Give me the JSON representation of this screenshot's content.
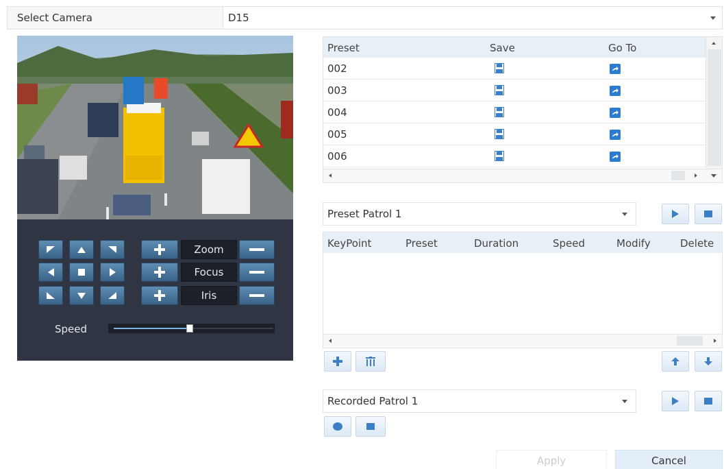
{
  "camera": {
    "label": "Select Camera",
    "value": "D15"
  },
  "ptz": {
    "zoom_label": "Zoom",
    "focus_label": "Focus",
    "iris_label": "Iris",
    "speed_label": "Speed",
    "speed_level_fraction": 0.47
  },
  "preset_table": {
    "headers": {
      "preset": "Preset",
      "save": "Save",
      "goto": "Go To"
    },
    "rows": [
      {
        "preset": "002"
      },
      {
        "preset": "003"
      },
      {
        "preset": "004"
      },
      {
        "preset": "005"
      },
      {
        "preset": "006"
      }
    ]
  },
  "preset_patrol": {
    "selected": "Preset Patrol 1",
    "headers": {
      "keypoint": "KeyPoint",
      "preset": "Preset",
      "duration": "Duration",
      "speed": "Speed",
      "modify": "Modify",
      "delete": "Delete"
    }
  },
  "recorded_patrol": {
    "selected": "Recorded Patrol 1"
  },
  "footer": {
    "apply_label": "Apply",
    "cancel_label": "Cancel"
  },
  "colors": {
    "accent": "#3d7fc4",
    "ptz_panel": "#2f3542",
    "header_bg": "#e8f0f7",
    "save_icon": "#3d7fc4",
    "goto_icon": "#2f7bd0"
  },
  "icons": [
    "chevron-down-icon",
    "save-icon",
    "goto-icon",
    "play-icon",
    "stop-icon",
    "plus-icon",
    "delete-icon",
    "arrow-up-icon",
    "arrow-down-icon",
    "record-icon",
    "minus-icon"
  ]
}
